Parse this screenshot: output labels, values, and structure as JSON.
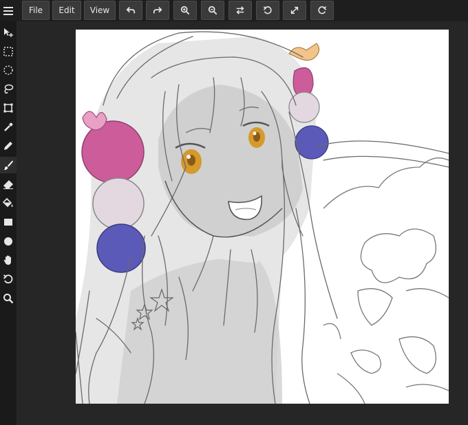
{
  "menu": {
    "file_label": "File",
    "edit_label": "Edit",
    "view_label": "View"
  },
  "toolbar_icons": [
    "undo-icon",
    "redo-icon",
    "zoom-in-icon",
    "zoom-out-icon",
    "flip-icon",
    "rotate-left-icon",
    "fullscreen-icon",
    "rotate-right-icon"
  ],
  "tools": [
    "move-tool",
    "rect-select-tool",
    "ellipse-select-tool",
    "lasso-tool",
    "transform-tool",
    "eyedropper-tool",
    "pencil-tool",
    "brush-tool",
    "eraser-tool",
    "fill-tool",
    "rectangle-shape-tool",
    "ellipse-shape-tool",
    "hand-tool",
    "rotate-view-tool",
    "zoom-tool"
  ],
  "active_tool": "brush-tool",
  "colors": {
    "pink": "#cc5c9a",
    "lavender": "#e3d8e0",
    "blue": "#5b5ab8",
    "eye": "#d59a2c",
    "ui_dark": "#1e1e1e"
  }
}
